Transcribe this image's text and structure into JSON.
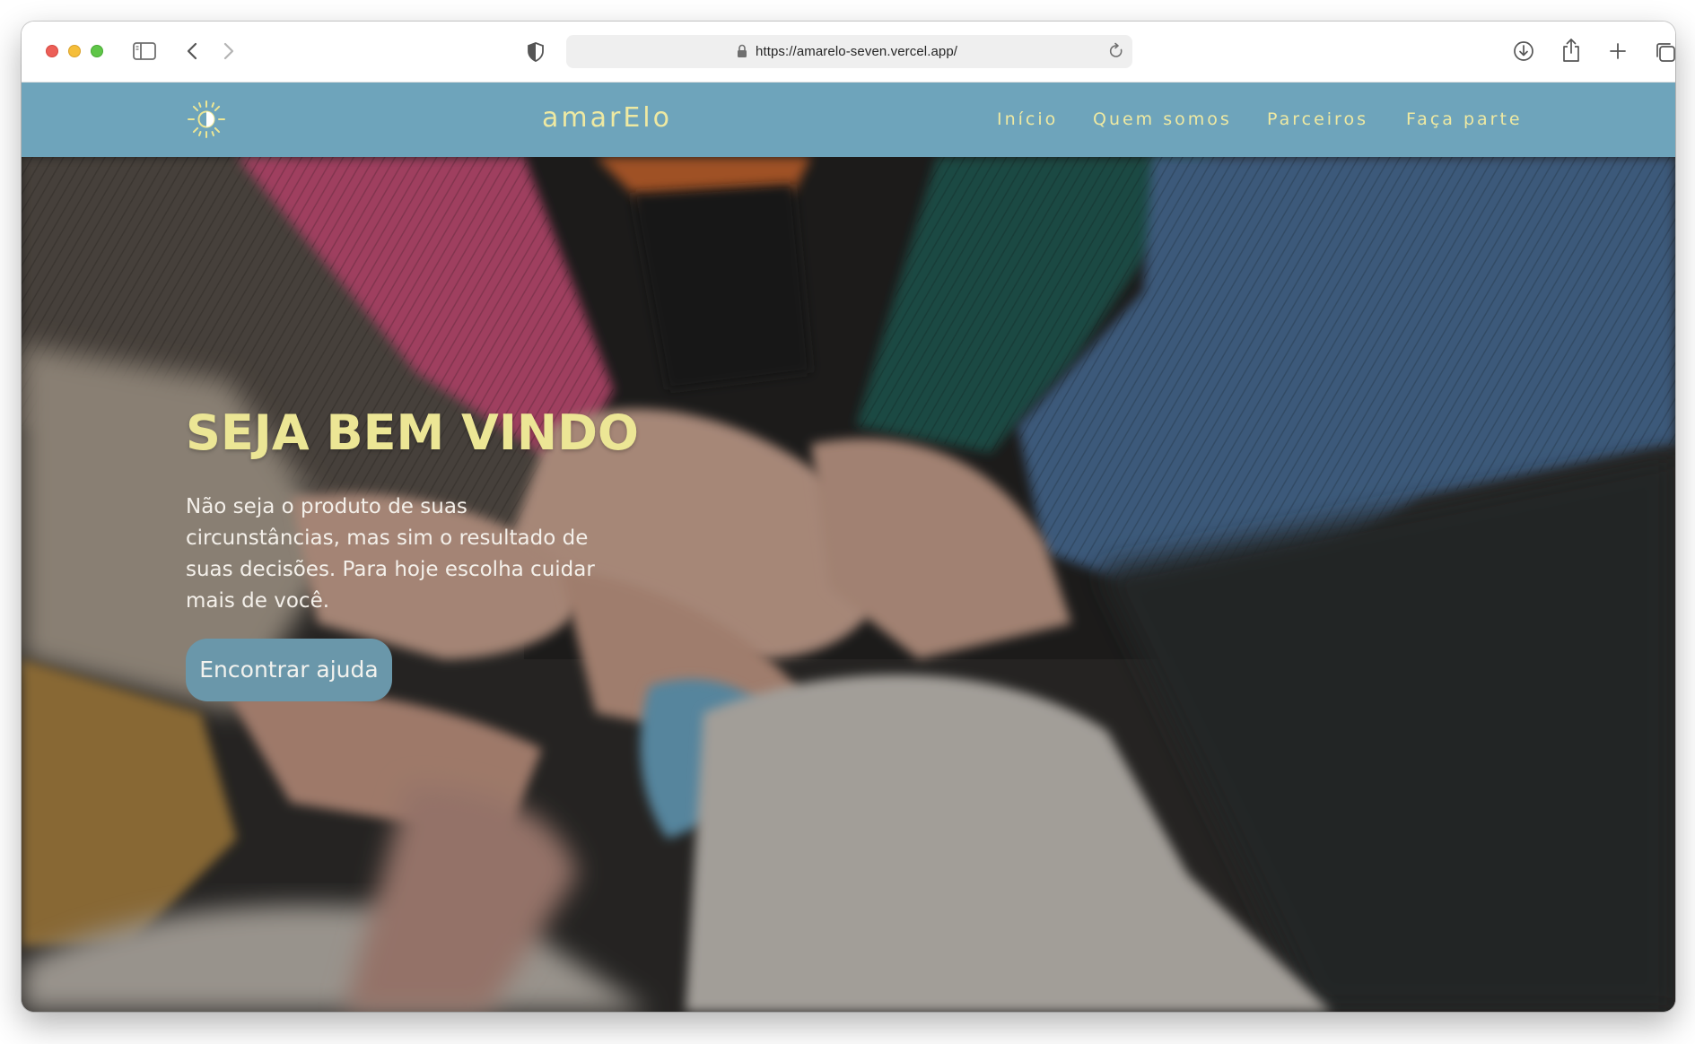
{
  "browser": {
    "url": "https://amarelo-seven.vercel.app/"
  },
  "site": {
    "brand": "amarElo",
    "nav": [
      {
        "label": "Início"
      },
      {
        "label": "Quem somos"
      },
      {
        "label": "Parceiros"
      },
      {
        "label": "Faça parte"
      }
    ]
  },
  "hero": {
    "title": "SEJA BEM VINDO",
    "text": "Não seja o produto de suas circunstâncias, mas sim o resultado de suas decisões. Para hoje escolha cuidar mais de você.",
    "cta_label": "Encontrar ajuda"
  },
  "colors": {
    "nav_bg": "#6ea4bb",
    "accent_yellow": "#ece695",
    "cta_bg": "#6a97aa"
  }
}
